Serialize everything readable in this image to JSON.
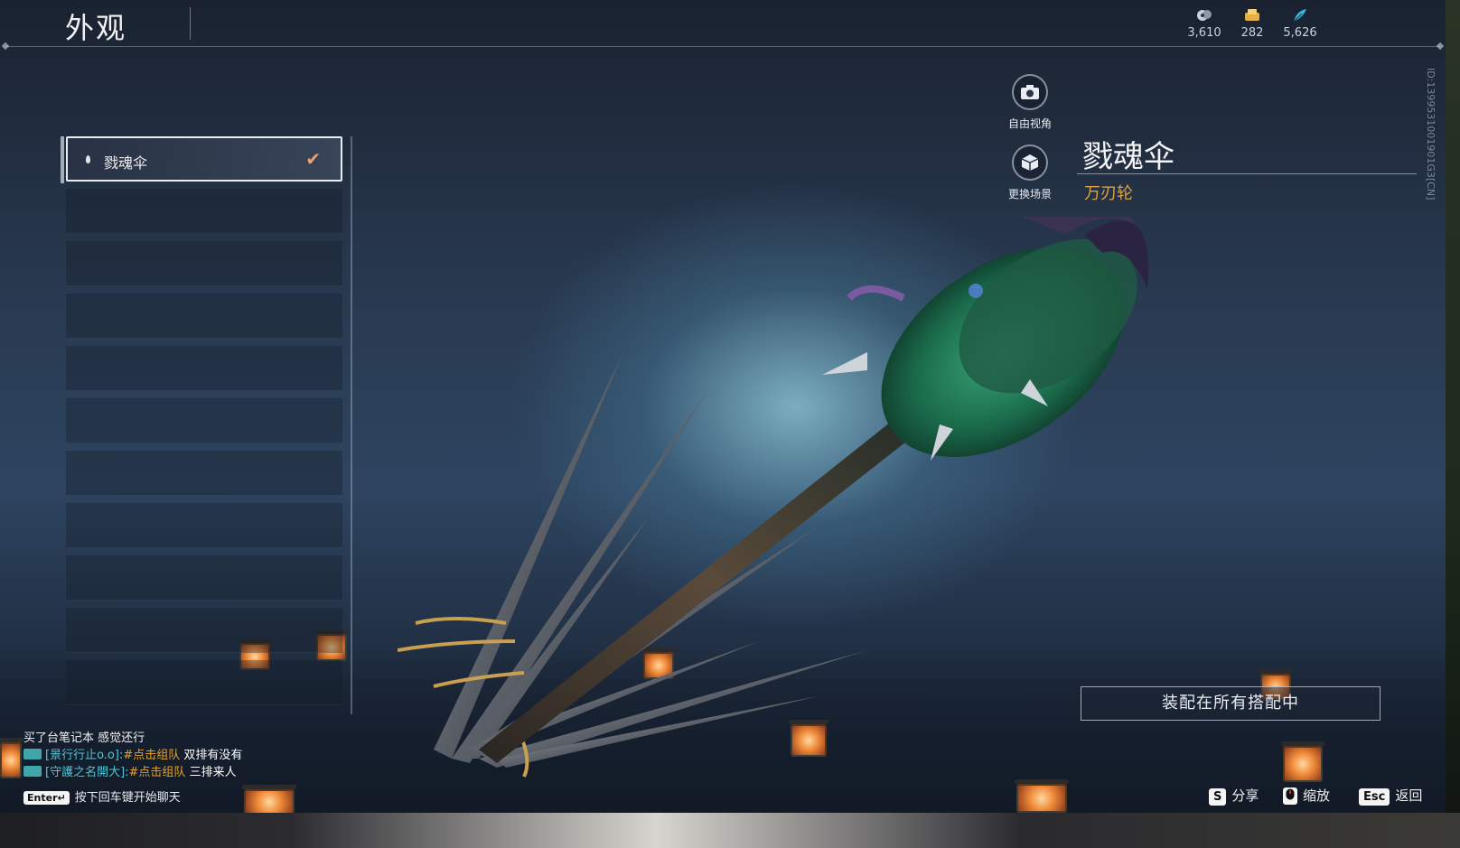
{
  "header": {
    "title": "外观",
    "currencies": [
      {
        "icon": "spirit-coin-icon",
        "value": "3,610",
        "color": "#c9d2dc"
      },
      {
        "icon": "gold-ticket-icon",
        "value": "282",
        "color": "#e8b040"
      },
      {
        "icon": "feather-icon",
        "value": "5,626",
        "color": "#38b8e0"
      }
    ]
  },
  "side_id": "ID:1399531001901G3[CN]",
  "skin_list": {
    "items": [
      {
        "label": "戮魂伞",
        "selected": true,
        "icon": "skin-drop-icon",
        "check_icon": "check-icon"
      }
    ],
    "empty_slots": 11
  },
  "camera_controls": {
    "free_view_label": "自由视角",
    "free_view_icon": "camera-icon",
    "change_scene_label": "更换场景",
    "change_scene_icon": "scene-box-icon"
  },
  "item": {
    "name": "戮魂伞",
    "subtitle": "万刃轮"
  },
  "equip_button": "装配在所有搭配中",
  "chat": {
    "lines": [
      {
        "type": "plain",
        "text": "买了台笔记本 感觉还行"
      },
      {
        "type": "team",
        "name": "[景行行止o.o]:",
        "link": "#点击组队",
        "msg": " 双排有没有"
      },
      {
        "type": "team",
        "name": "[守護之名開大]:",
        "link": "#点击组队",
        "msg": " 三排来人"
      }
    ],
    "enter_key": "Enter↵",
    "enter_hint": "按下回车键开始聊天"
  },
  "key_hints": [
    {
      "key": "S",
      "label": "分享"
    },
    {
      "key": "",
      "label": "缩放",
      "icon": "mouse-icon"
    },
    {
      "key": "Esc",
      "label": "返回"
    }
  ],
  "colors": {
    "accent_orange": "#f0a070",
    "subtitle_gold": "#e0a040",
    "chat_name": "#51c6d6",
    "chat_link": "#e2a12f"
  }
}
